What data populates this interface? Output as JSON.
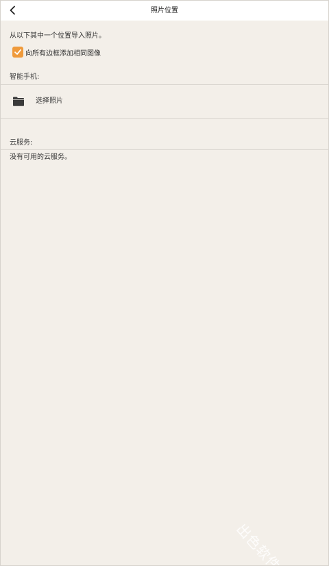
{
  "header": {
    "title": "照片位置",
    "back_icon": "chevron-left-icon"
  },
  "intro_text": "从以下其中一个位置导入照片。",
  "checkbox": {
    "label": "向所有边框添加相同图像",
    "checked": true,
    "color": "#ef9a3b"
  },
  "smartphone": {
    "section_label": "智能手机:",
    "select_label": "选择照片",
    "icon": "folder-icon"
  },
  "cloud": {
    "section_label": "云服务:",
    "empty_text": "没有可用的云服务。"
  },
  "watermark": "出色软件站",
  "colors": {
    "background": "#f3efe9",
    "header_bg": "#ffffff",
    "accent": "#ef9a3b",
    "divider": "#d9d5cf"
  }
}
